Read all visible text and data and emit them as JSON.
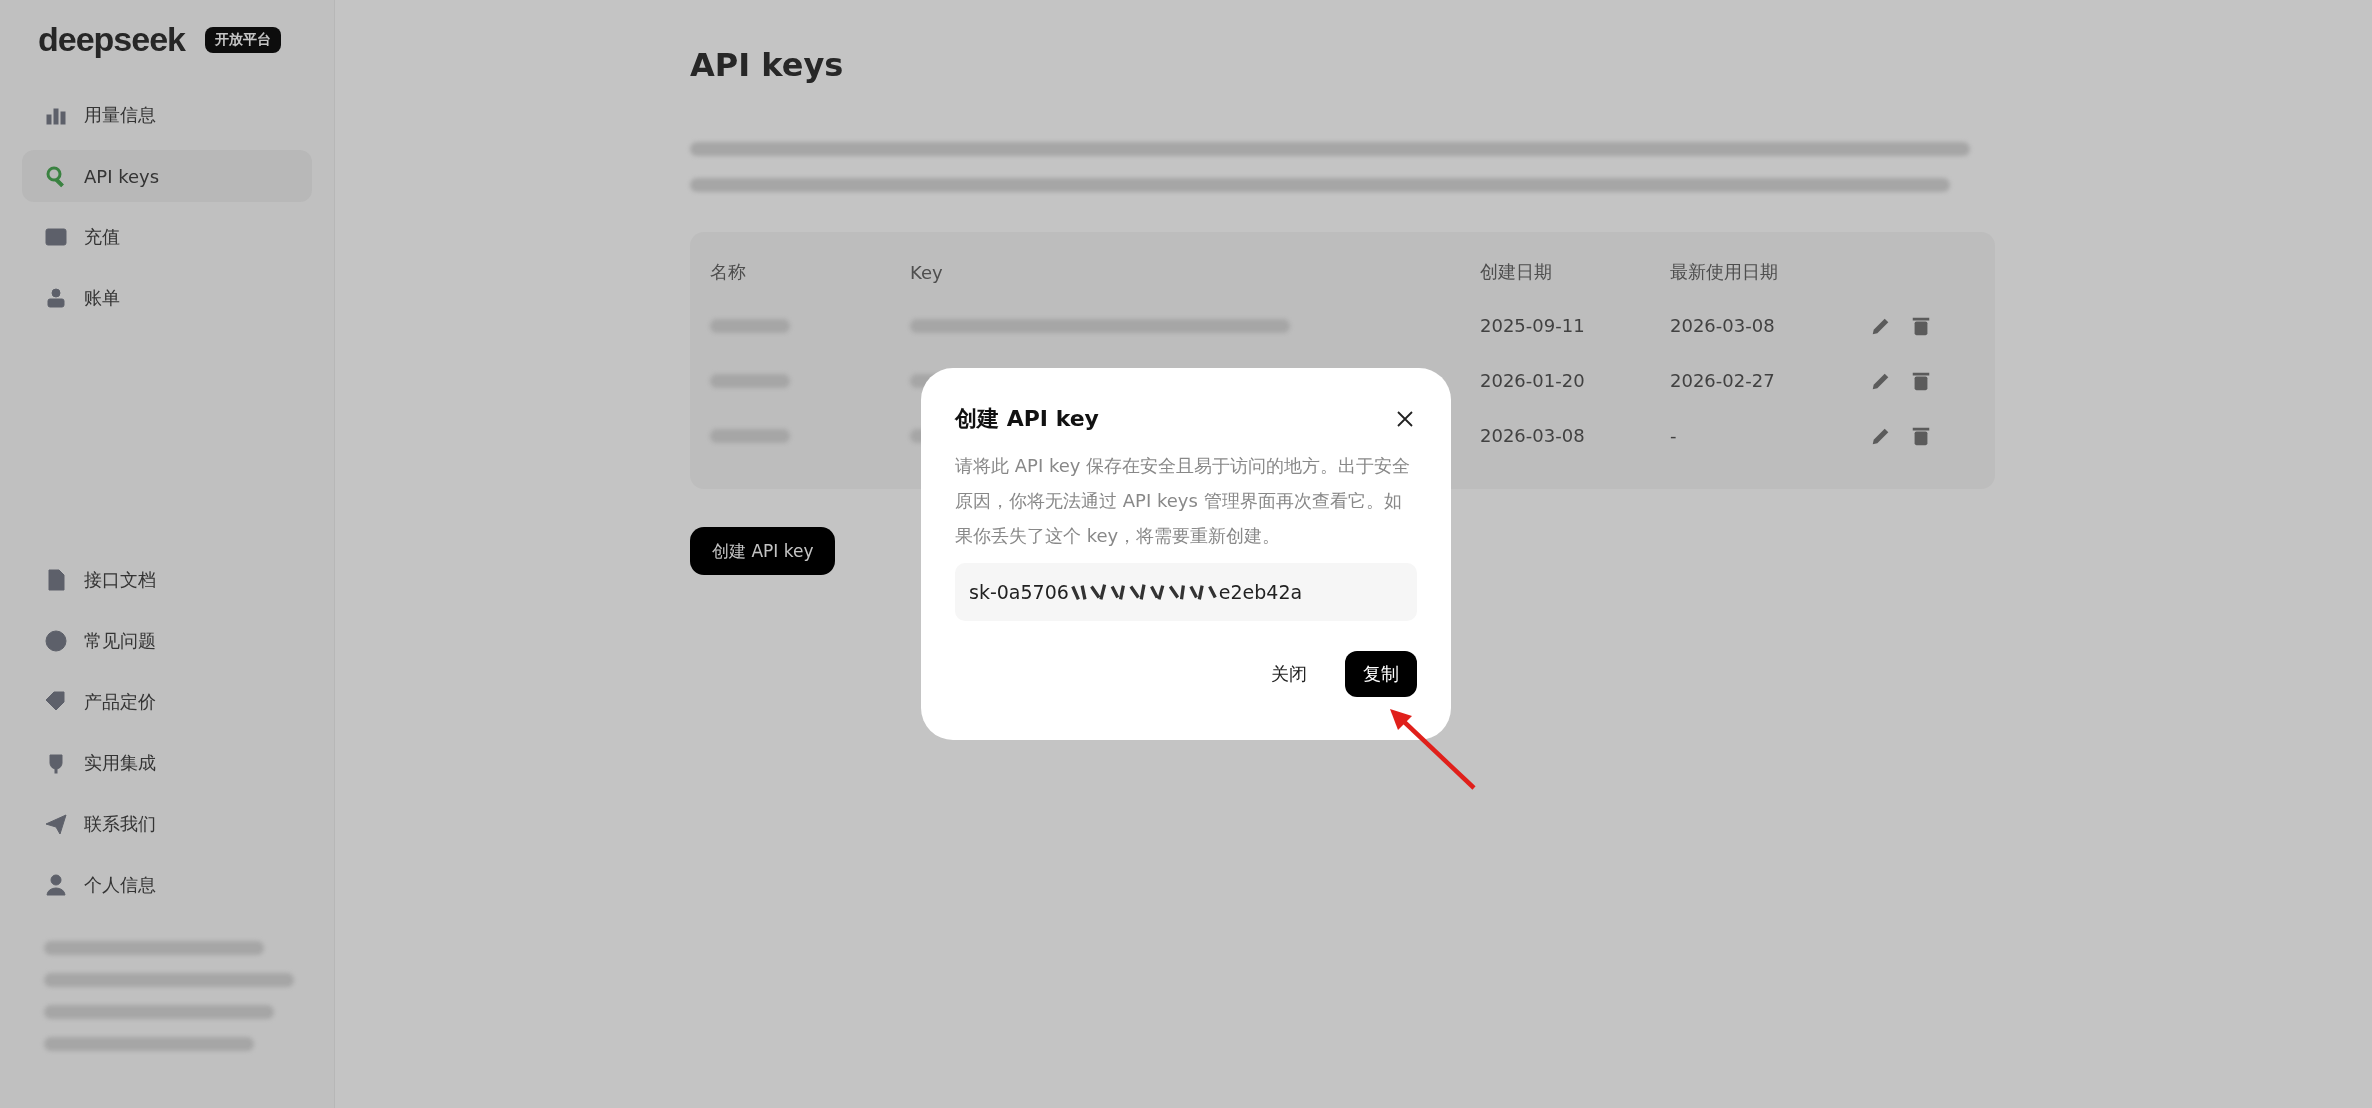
{
  "sidebar": {
    "logo": "deepseek",
    "badge": "开放平台",
    "items": [
      {
        "label": "用量信息",
        "selected": false
      },
      {
        "label": "API keys",
        "selected": true
      },
      {
        "label": "充值",
        "selected": false
      },
      {
        "label": "账单",
        "selected": false
      }
    ],
    "bottom_items": [
      {
        "label": "接口文档"
      },
      {
        "label": "常见问题"
      },
      {
        "label": "产品定价"
      },
      {
        "label": "实用集成"
      },
      {
        "label": "联系我们"
      },
      {
        "label": "个人信息"
      }
    ]
  },
  "page": {
    "title": "API keys",
    "table": {
      "columns": [
        "名称",
        "Key",
        "创建日期",
        "最新使用日期"
      ],
      "rows": [
        {
          "created": "2025-09-11",
          "last_used": "2026-03-08"
        },
        {
          "created": "2026-01-20",
          "last_used": "2026-02-27"
        },
        {
          "created": "2026-03-08",
          "last_used": "-"
        }
      ]
    },
    "create_button": "创建 API key"
  },
  "dialog": {
    "title": "创建 API key",
    "message": "请将此 API key 保存在安全且易于访问的地方。出于安全原因，你将无法通过 API keys 管理界面再次查看它。如果你丢失了这个 key，将需要重新创建。",
    "key_start": "sk-0a5706",
    "key_end": "e2eb42a",
    "buttons": [
      {
        "label": "关闭",
        "kind": "text"
      },
      {
        "label": "复制",
        "kind": "primary"
      }
    ]
  }
}
